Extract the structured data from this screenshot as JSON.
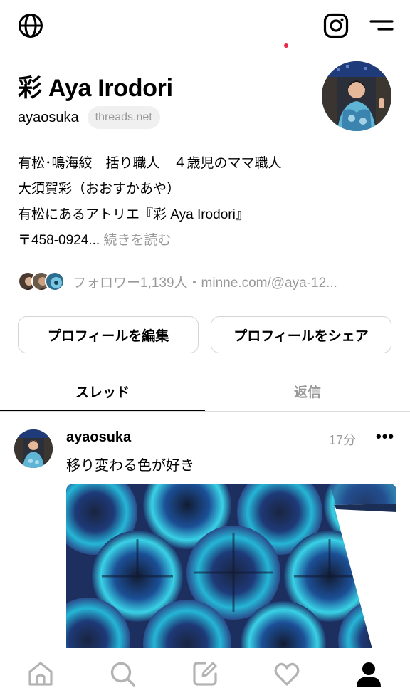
{
  "profile": {
    "display_name": "彩 Aya Irodori",
    "username": "ayaosuka",
    "domain_badge": "threads.net",
    "bio_lines": [
      "有松･鳴海絞　括り職人　４歳児のママ職人",
      "大須賀彩（おおすかあや）",
      "有松にあるアトリエ『彩 Aya Irodori』"
    ],
    "bio_last_line": "〒458-0924...",
    "bio_more": "続きを読む",
    "followers_text": "フォロワー1,139人・minne.com/@aya-12..."
  },
  "buttons": {
    "edit_profile": "プロフィールを編集",
    "share_profile": "プロフィールをシェア"
  },
  "tabs": {
    "threads": "スレッド",
    "replies": "返信"
  },
  "post": {
    "username": "ayaosuka",
    "time": "17分",
    "more": "•••",
    "text": "移り変わる色が好き"
  },
  "icons": {
    "top_left": "globe-icon",
    "top_right_1": "instagram-icon",
    "top_right_2": "menu-icon",
    "nav": [
      "home-icon",
      "search-icon",
      "compose-icon",
      "heart-icon",
      "profile-icon"
    ]
  },
  "colors": {
    "secondary_text": "#999999",
    "notification_dot": "#e8284a",
    "dye_dark": "#1b2a4a",
    "dye_cyan": "#2fd0e0"
  }
}
